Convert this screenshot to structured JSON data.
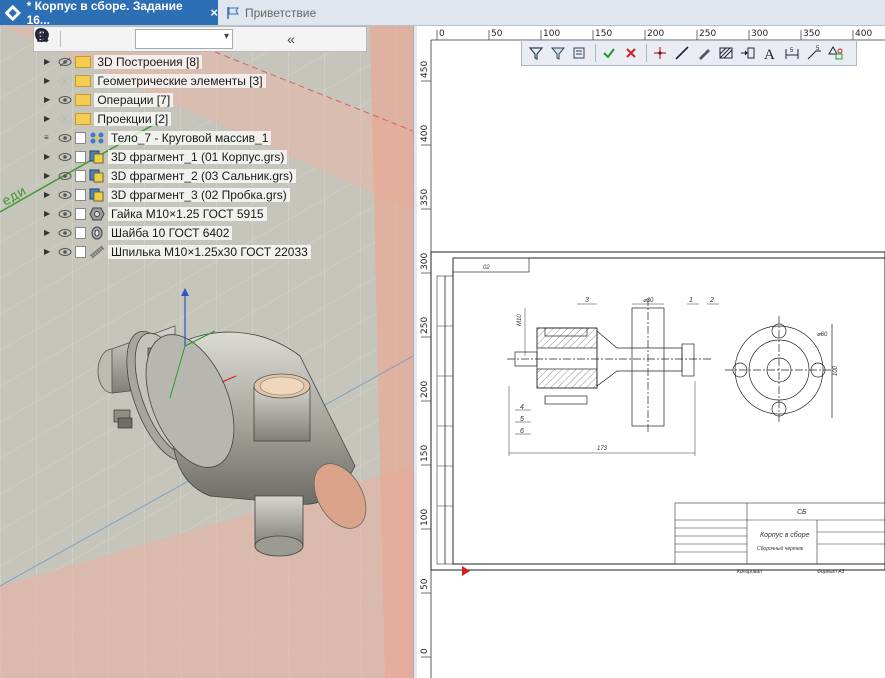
{
  "tabs": {
    "active_label": "* Корпус в сборе. Задание 16...",
    "active_close": "×",
    "inactive_label": "Приветствие"
  },
  "tree_toolbar": {
    "close_icon": "×",
    "collapse_icon": "«"
  },
  "tree": {
    "items": [
      {
        "label": "3D Построения [8]",
        "icon": "folder"
      },
      {
        "label": "Геометрические элементы [3]",
        "icon": "folder"
      },
      {
        "label": "Операции [7]",
        "icon": "folder"
      },
      {
        "label": "Проекции [2]",
        "icon": "folder"
      },
      {
        "label": "Тело_7 - Круговой массив_1",
        "icon": "body"
      },
      {
        "label": "3D фрагмент_1 (01 Корпус.grs)",
        "icon": "fragment"
      },
      {
        "label": "3D фрагмент_2 (03 Сальник.grs)",
        "icon": "fragment"
      },
      {
        "label": "3D фрагмент_3 (02 Пробка.grs)",
        "icon": "fragment"
      },
      {
        "label": "Гайка М10×1.25 ГОСТ 5915",
        "icon": "nut"
      },
      {
        "label": "Шайба 10 ГОСТ 6402",
        "icon": "washer"
      },
      {
        "label": "Шпилька М10×1.25х30 ГОСТ 22033",
        "icon": "stud"
      }
    ]
  },
  "view3d": {
    "plane_label": "еди"
  },
  "ruler": {
    "top_ticks": [
      "0",
      "50",
      "100",
      "150",
      "200",
      "250",
      "300",
      "350",
      "400"
    ],
    "left_ticks": [
      "450",
      "400",
      "350",
      "300",
      "250",
      "200",
      "150",
      "100",
      "50",
      "0"
    ]
  },
  "sheet": {
    "top_block": "02",
    "title": "Корпус в сборе",
    "subtitle": "Сборочный чертеж",
    "code": "СБ",
    "dims": {
      "d30_top": "⌀30",
      "d60": "⌀60",
      "m": "M10",
      "len": "173",
      "h": "100"
    },
    "callouts": [
      "3",
      "1",
      "2",
      "4",
      "5",
      "6"
    ],
    "footer_left": "Копировал",
    "footer_right": "Формат А3"
  },
  "colors": {
    "tab_active_bg": "#2d6fb5",
    "part_body": "#b9b8b0",
    "part_end": "#dba48a",
    "plane_pink": "#e9b0a0"
  }
}
